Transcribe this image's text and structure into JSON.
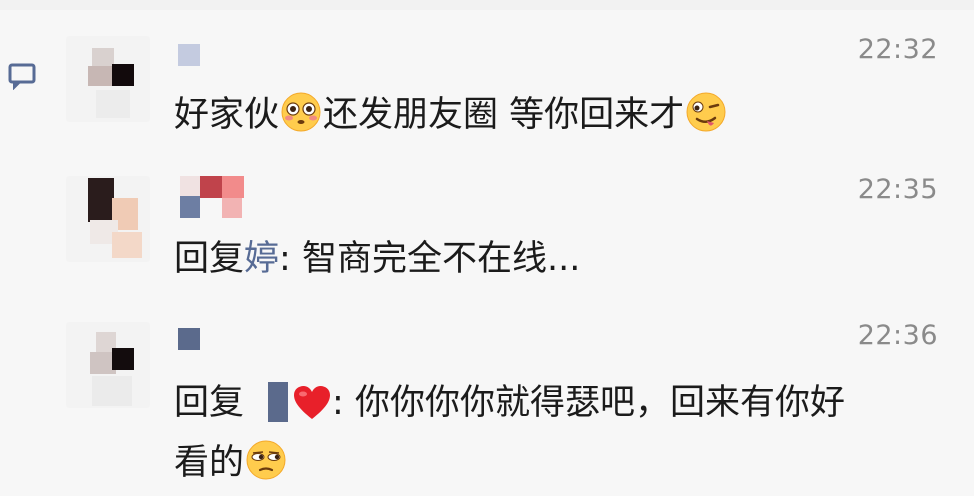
{
  "comments": [
    {
      "time": "22:32",
      "text_a": "好家伙",
      "text_b": "还发朋友圈 等你回来才",
      "emoji_1": "flushed-face-icon",
      "emoji_2": "zany-face-icon"
    },
    {
      "time": "22:35",
      "reply_prefix": "回复",
      "reply_to": "婷",
      "colon": ":",
      "text": " 智商完全不在线..."
    },
    {
      "time": "22:36",
      "reply_prefix": "回复",
      "colon": ":",
      "text": " 你你你你就得瑟吧，回来有你好",
      "text_line2": "看的",
      "emoji": "unamused-face-icon",
      "heart": "red-heart-icon"
    }
  ],
  "colors": {
    "background": "#f7f7f7",
    "text": "#1b1b1b",
    "time": "#8a8a8a",
    "link": "#576b95"
  }
}
